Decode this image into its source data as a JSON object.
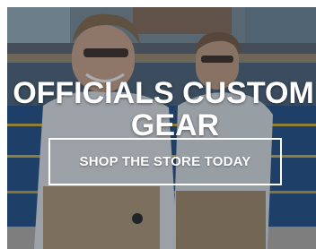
{
  "promo": {
    "headline_line1": "OFFICIALS CUSTOM",
    "headline_line2": "GEAR",
    "cta_label": "SHOP THE STORE TODAY"
  },
  "colors": {
    "text": "#ffffff",
    "overlay": "#1d2733",
    "pool_water": "#1f4f8a",
    "lane_rope_yellow": "#d8b43a"
  }
}
